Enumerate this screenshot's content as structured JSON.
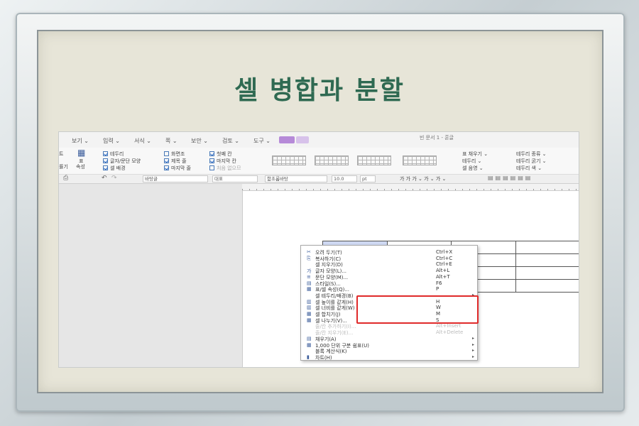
{
  "slide": {
    "title": "셀 병합과 분할"
  },
  "app": {
    "doc_title": "빈 문서 1 - 훈글",
    "menus": [
      "보기 ⌄",
      "입력 ⌄",
      "서식 ⌄",
      "쪽 ⌄",
      "보안 ⌄",
      "검토 ⌄",
      "도구 ⌄"
    ],
    "ribbon_checks_col1": [
      {
        "label": "테두리",
        "checked": true
      },
      {
        "label": "글자/문단 모양",
        "checked": true
      },
      {
        "label": "셀 배경",
        "checked": true
      }
    ],
    "ribbon_checks_col2": [
      {
        "label": "화면조",
        "checked": false
      },
      {
        "label": "제목 줄",
        "checked": true
      },
      {
        "label": "마지막 줄",
        "checked": true
      }
    ],
    "ribbon_checks_col3": [
      {
        "label": "첫째 칸",
        "checked": true
      },
      {
        "label": "마지막 칸",
        "checked": true
      },
      {
        "label": "처음 없으므",
        "checked": false
      }
    ],
    "ribbon_right": [
      "표 채우기 ⌄",
      "테두리 ⌄",
      "셀 음영 ⌄",
      "테두리 종류 ⌄",
      "테두리 굵기 ⌄",
      "테두리 색 ⌄"
    ],
    "left_labels": [
      "트",
      "률기",
      "표",
      "속성"
    ],
    "format_bar": {
      "style": "바탕글",
      "lang": "대표",
      "font": "함초롬바탕",
      "size": "10.0",
      "unit": "pt",
      "format_buttons": "가  가  가 ⌄  가 ⌄  가 ⌄"
    }
  },
  "context_menu": {
    "items": [
      {
        "icon": "✂",
        "label": "오려 두기(T)",
        "shortcut": "Ctrl+X",
        "arrow": "",
        "dim": false
      },
      {
        "icon": "⎘",
        "label": "복사하기(C)",
        "shortcut": "Ctrl+C",
        "arrow": "",
        "dim": false
      },
      {
        "icon": "",
        "label": "셀 지우기(D)",
        "shortcut": "Ctrl+E",
        "arrow": "",
        "dim": false
      },
      {
        "icon": "가",
        "label": "글자 모양(L)...",
        "shortcut": "Alt+L",
        "arrow": "",
        "dim": false
      },
      {
        "icon": "≡",
        "label": "문단 모양(M)...",
        "shortcut": "Alt+T",
        "arrow": "",
        "dim": false
      },
      {
        "icon": "▤",
        "label": "스타일(S)...",
        "shortcut": "F6",
        "arrow": "",
        "dim": false
      },
      {
        "icon": "▦",
        "label": "표/셀 속성(Q)...",
        "shortcut": "P",
        "arrow": "",
        "dim": false
      },
      {
        "icon": "",
        "label": "셀 테두리/배경(B)",
        "shortcut": "",
        "arrow": "▸",
        "dim": false
      },
      {
        "icon": "▥",
        "label": "셀 높이를 같게(H)",
        "shortcut": "H",
        "arrow": "",
        "dim": false
      },
      {
        "icon": "▥",
        "label": "셀 너비를 같게(W)",
        "shortcut": "W",
        "arrow": "",
        "dim": false
      },
      {
        "icon": "▦",
        "label": "셀 합치기(J)",
        "shortcut": "M",
        "arrow": "",
        "dim": false
      },
      {
        "icon": "▦",
        "label": "셀 나누기(V)...",
        "shortcut": "S",
        "arrow": "",
        "dim": false
      },
      {
        "icon": "",
        "label": "줄/칸 추가하기(I)...",
        "shortcut": "Alt+Insert",
        "arrow": "",
        "dim": true
      },
      {
        "icon": "",
        "label": "줄/칸 지우기(E)...",
        "shortcut": "Alt+Delete",
        "arrow": "",
        "dim": true
      },
      {
        "icon": "▤",
        "label": "채우기(A)",
        "shortcut": "",
        "arrow": "▸",
        "dim": false
      },
      {
        "icon": "▦",
        "label": "1,000 단위 구분 쉼표(U)",
        "shortcut": "",
        "arrow": "▸",
        "dim": false
      },
      {
        "icon": "",
        "label": "블록 계산식(K)",
        "shortcut": "",
        "arrow": "▸",
        "dim": false
      },
      {
        "icon": "▮",
        "label": "차트(H)",
        "shortcut": "",
        "arrow": "▸",
        "dim": false
      }
    ]
  },
  "colors": {
    "title": "#2f6a52",
    "highlight_box": "#e02a2a",
    "selected_cell": "#cfd9f2"
  }
}
